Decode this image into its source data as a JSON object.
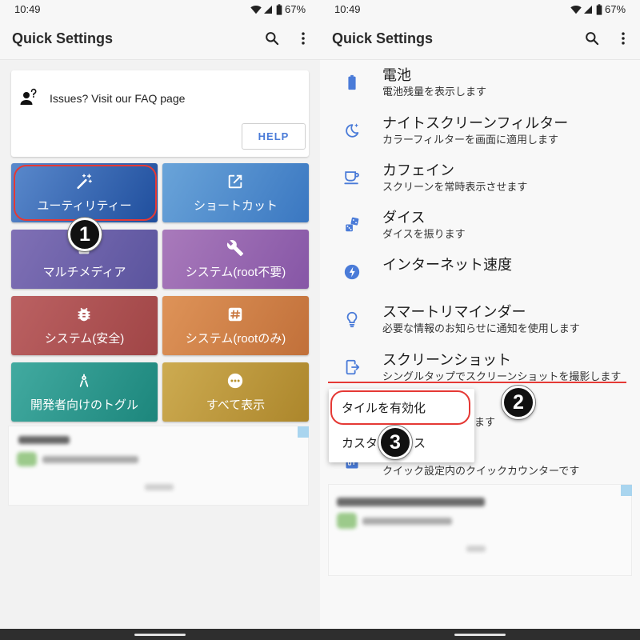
{
  "colors": {
    "accent": "#4a7bd8",
    "highlight_red": "#e53935"
  },
  "left": {
    "status_bar": {
      "time": "10:49",
      "battery": "67%",
      "icons": [
        "wifi-icon",
        "signal-icon",
        "battery-icon"
      ]
    },
    "app_bar": {
      "title": "Quick Settings",
      "actions": [
        "search-icon",
        "more-vert-icon"
      ]
    },
    "faq_card": {
      "icon": "person-question-icon",
      "text": "Issues? Visit our FAQ page",
      "button": "HELP"
    },
    "tiles": [
      {
        "label": "ユーティリティー",
        "icon": "magic-wand-icon",
        "colors": [
          "#5a89cc",
          "#1f4e9d"
        ]
      },
      {
        "label": "ショートカット",
        "icon": "open-in-new-icon",
        "colors": [
          "#6aa4d9",
          "#3a77c1"
        ]
      },
      {
        "label": "マルチメディア",
        "icon": "multimedia-icon",
        "colors": [
          "#8070b5",
          "#5a549e"
        ]
      },
      {
        "label": "システム(root不要)",
        "icon": "wrench-icon",
        "colors": [
          "#a97abb",
          "#8656a6"
        ]
      },
      {
        "label": "システム(安全)",
        "icon": "bug-icon",
        "colors": [
          "#bb6162",
          "#a04546"
        ]
      },
      {
        "label": "システム(rootのみ)",
        "icon": "hash-icon",
        "colors": [
          "#de9358",
          "#c1703a"
        ]
      },
      {
        "label": "開発者向けのトグル",
        "icon": "drafting-compass-icon",
        "colors": [
          "#42aaa0",
          "#1c867c"
        ]
      },
      {
        "label": "すべて表示",
        "icon": "more-horiz-icon",
        "colors": [
          "#cdab51",
          "#ac862b"
        ]
      }
    ],
    "annotation": "1"
  },
  "right": {
    "status_bar": {
      "time": "10:49",
      "battery": "67%",
      "icons": [
        "wifi-icon",
        "signal-icon",
        "battery-icon"
      ]
    },
    "app_bar": {
      "title": "Quick Settings",
      "actions": [
        "search-icon",
        "more-vert-icon"
      ]
    },
    "list": [
      {
        "title": "電池",
        "subtitle": "電池残量を表示します",
        "icon": "battery-icon"
      },
      {
        "title": "ナイトスクリーンフィルター",
        "subtitle": "カラーフィルターを画面に適用します",
        "icon": "night-moon-icon"
      },
      {
        "title": "カフェイン",
        "subtitle": "スクリーンを常時表示させます",
        "icon": "coffee-cup-icon"
      },
      {
        "title": "ダイス",
        "subtitle": "ダイスを振ります",
        "icon": "dice-icon"
      },
      {
        "title": "インターネット速度",
        "icon": "speed-icon"
      },
      {
        "title": "スマートリマインダー",
        "subtitle": "必要な情報のお知らせに通知を使用します",
        "icon": "lightbulb-icon"
      },
      {
        "title": "スクリーンショット",
        "subtitle": "シングルタップでスクリーンショットを撮影します",
        "icon": "screenshot-icon"
      }
    ],
    "partial_items": [
      {
        "subtitle_visible": "ます"
      },
      {
        "subtitle": "クイック設定内のクイックカウンターです",
        "icon": "counter-icon"
      }
    ],
    "context_menu": {
      "items": [
        {
          "label": "タイルを有効化"
        },
        {
          "visible_start": "カスタ",
          "visible_end": "ス"
        }
      ]
    },
    "annotations": [
      "2",
      "3"
    ]
  }
}
